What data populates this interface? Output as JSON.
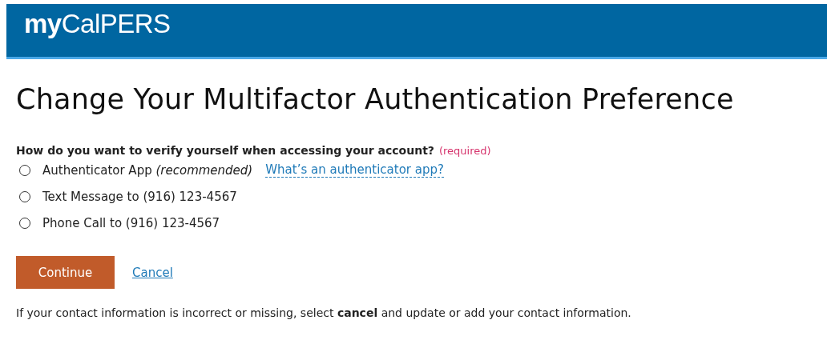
{
  "header": {
    "logo": "**my**CalPERS"
  },
  "title": "Change Your Multifactor Authentication Preference",
  "question": {
    "label": "How do you want to verify yourself when accessing your account?",
    "required": "(required)"
  },
  "options": [
    {
      "label": "Authenticator App *(recommended)*",
      "selected": false,
      "link": "What’s an authenticator app?"
    },
    {
      "label": "Text Message to (916) 123-4567",
      "selected": false
    },
    {
      "label": "Phone Call to (916) 123-4567",
      "selected": false
    }
  ],
  "buttons": {
    "primary": "Continue",
    "secondary": "Cancel"
  },
  "note": "If your contact information is incorrect or missing, select **cancel** and update or add your contact information."
}
